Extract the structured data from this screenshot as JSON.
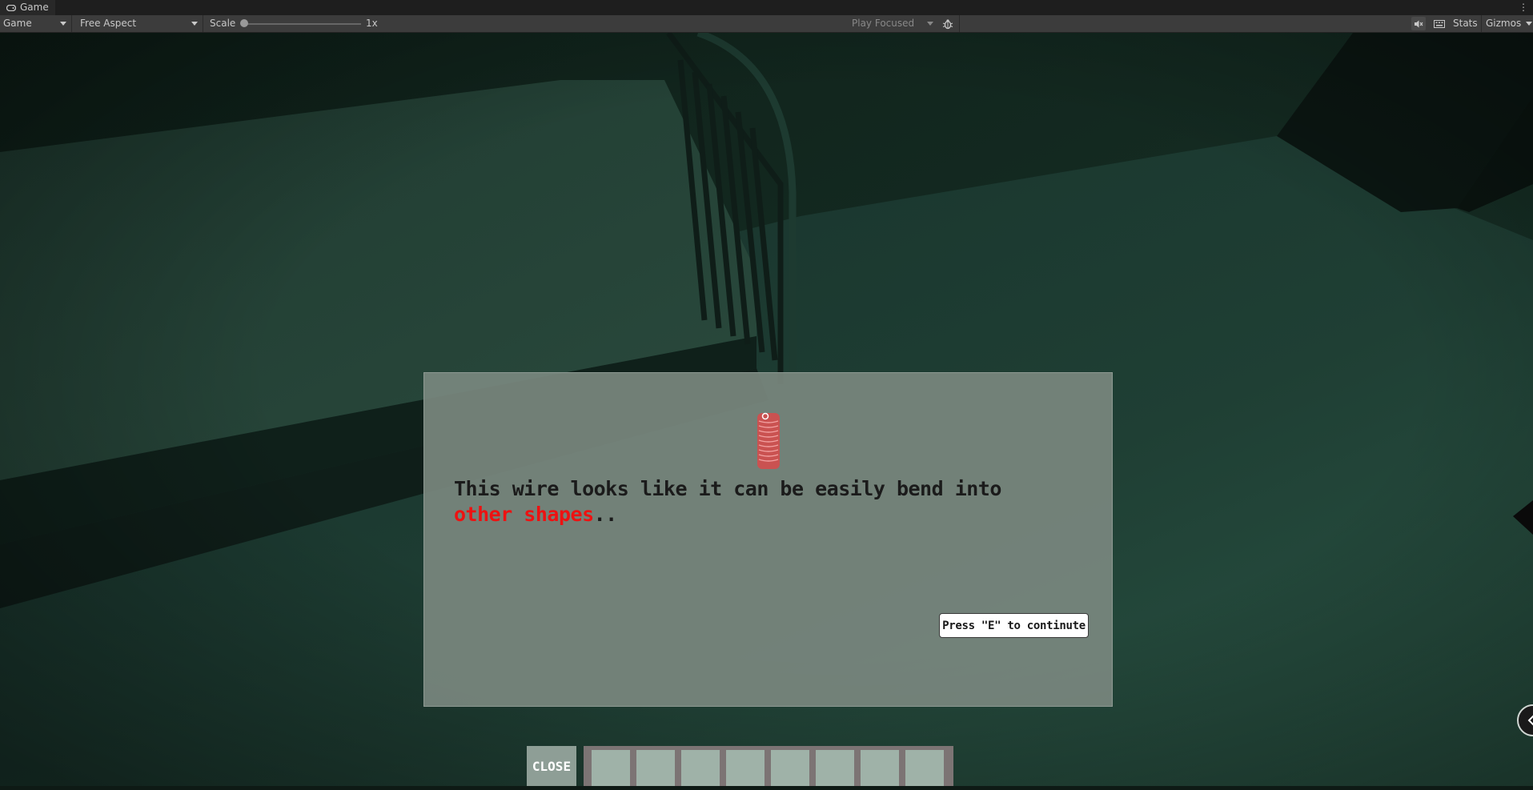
{
  "window": {
    "tab_title": "Game",
    "tab_icon": "gamepad-icon"
  },
  "toolbar": {
    "display": "Game",
    "aspect": "Free Aspect",
    "scale_label": "Scale",
    "scale_value": "1x",
    "scale_fraction": 0.0,
    "play_mode": "Play Focused",
    "stats": "Stats",
    "gizmos": "Gizmos"
  },
  "dialog": {
    "text_plain": "This wire looks like it can be easily bend into ",
    "text_highlight": "other shapes",
    "text_suffix": "..",
    "highlight_color": "#ee1111",
    "continue_label": "Press \"E\" to continute",
    "item_icon": "coiled-wire-icon"
  },
  "inventory": {
    "close_label": "CLOSE",
    "slots": [
      "",
      "",
      "",
      "",
      "",
      "",
      "",
      ""
    ]
  },
  "colors": {
    "scene_bg": "#152820",
    "dialog_bg": "#78867e",
    "slot_bg": "#9fb2a8",
    "inventory_frame": "#7c7474"
  }
}
